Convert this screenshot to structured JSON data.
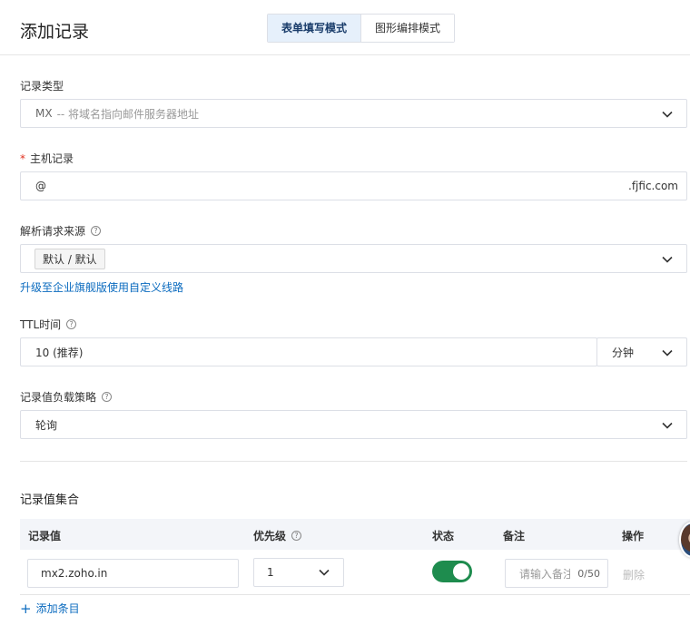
{
  "header": {
    "title": "添加记录",
    "modes": [
      "表单填写模式",
      "图形编排模式"
    ]
  },
  "record_type": {
    "label": "记录类型",
    "value_code": "MX",
    "value_desc": "-- 将域名指向邮件服务器地址"
  },
  "host_record": {
    "label": "主机记录",
    "required_mark": "*",
    "value": "@",
    "suffix": ".fjfic.com"
  },
  "resolve_source": {
    "label": "解析请求来源",
    "value": "默认 / 默认",
    "upgrade_link": "升级至企业旗舰版使用自定义线路"
  },
  "ttl": {
    "label": "TTL时间",
    "value": "10 (推荐)",
    "unit": "分钟"
  },
  "load_strategy": {
    "label": "记录值负载策略",
    "value": "轮询"
  },
  "record_set": {
    "title": "记录值集合",
    "columns": [
      "记录值",
      "优先级",
      "状态",
      "备注",
      "操作"
    ],
    "rows": [
      {
        "record_value": "mx2.zoho.in",
        "priority": "1",
        "enabled": true,
        "remark_placeholder": "请输入备注",
        "remark_count": "0/50",
        "action": "删除"
      }
    ],
    "add_label": "添加条目"
  },
  "colors": {
    "accent": "#0b6bbf",
    "toggle_on": "#1e8c4e",
    "required": "#e0301e"
  },
  "icons": {
    "help": "question-circle-icon",
    "dropdown": "chevron-down-icon",
    "add": "plus-icon"
  }
}
